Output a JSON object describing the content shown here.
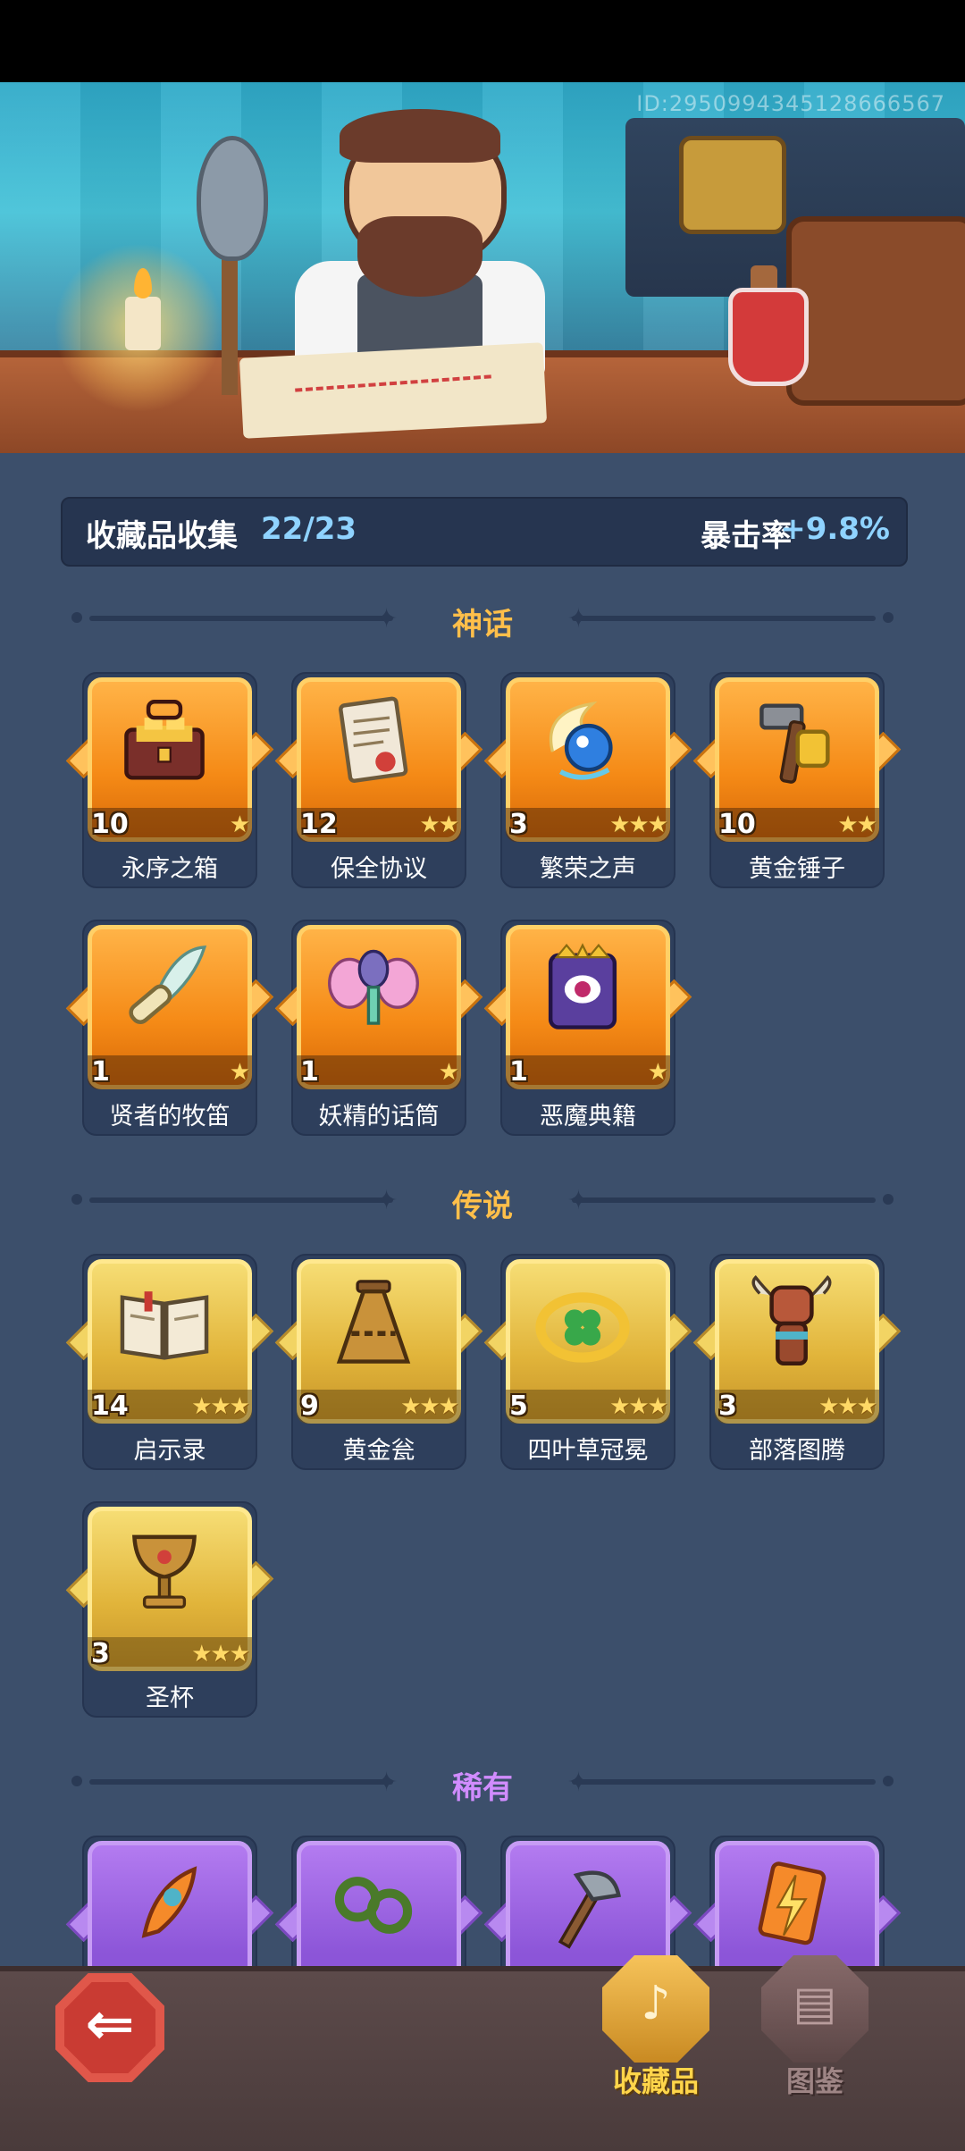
{
  "banner": {
    "id_text": "ID:2950994345128666567"
  },
  "stats": {
    "title": "收藏品收集",
    "count": "22/23",
    "crit_label": "暴击率",
    "crit_value": "+9.8%"
  },
  "sections": {
    "mythic": {
      "title": "神话"
    },
    "legend": {
      "title": "传说"
    },
    "rare": {
      "title": "稀有"
    }
  },
  "mythic_items": [
    {
      "name": "永序之箱",
      "level": "10",
      "stars": "★",
      "icon": "treasure-chest-icon"
    },
    {
      "name": "保全协议",
      "level": "12",
      "stars": "★★",
      "icon": "scroll-document-icon"
    },
    {
      "name": "繁荣之声",
      "level": "3",
      "stars": "★★★",
      "icon": "spirit-orb-icon"
    },
    {
      "name": "黄金锤子",
      "level": "10",
      "stars": "★★",
      "icon": "golden-hammer-icon"
    },
    {
      "name": "贤者的牧笛",
      "level": "1",
      "stars": "★",
      "icon": "feather-flute-icon"
    },
    {
      "name": "妖精的话筒",
      "level": "1",
      "stars": "★",
      "icon": "fairy-microphone-icon"
    },
    {
      "name": "恶魔典籍",
      "level": "1",
      "stars": "★",
      "icon": "demon-tome-icon"
    }
  ],
  "legend_items": [
    {
      "name": "启示录",
      "level": "14",
      "stars": "★★★",
      "icon": "open-book-icon"
    },
    {
      "name": "黄金瓮",
      "level": "9",
      "stars": "★★★",
      "icon": "golden-urn-icon"
    },
    {
      "name": "四叶草冠冕",
      "level": "5",
      "stars": "★★★",
      "icon": "clover-crown-icon"
    },
    {
      "name": "部落图腾",
      "level": "3",
      "stars": "★★★",
      "icon": "tribal-totem-icon"
    },
    {
      "name": "圣杯",
      "level": "3",
      "stars": "★★★",
      "icon": "holy-grail-icon"
    }
  ],
  "rare_items": [
    {
      "icon": "flame-feather-icon"
    },
    {
      "icon": "thorn-vine-icon"
    },
    {
      "icon": "axe-icon"
    },
    {
      "icon": "lightning-card-icon"
    }
  ],
  "nav": {
    "back": "back-arrow-icon",
    "collection_label": "收藏品",
    "codex_label": "图鉴"
  },
  "colors": {
    "mythic": "#f58a16",
    "legend": "#e1b43a",
    "rare": "#8c55d8",
    "highlight": "#8fd3ff",
    "section_title": "#ffbf4a"
  }
}
